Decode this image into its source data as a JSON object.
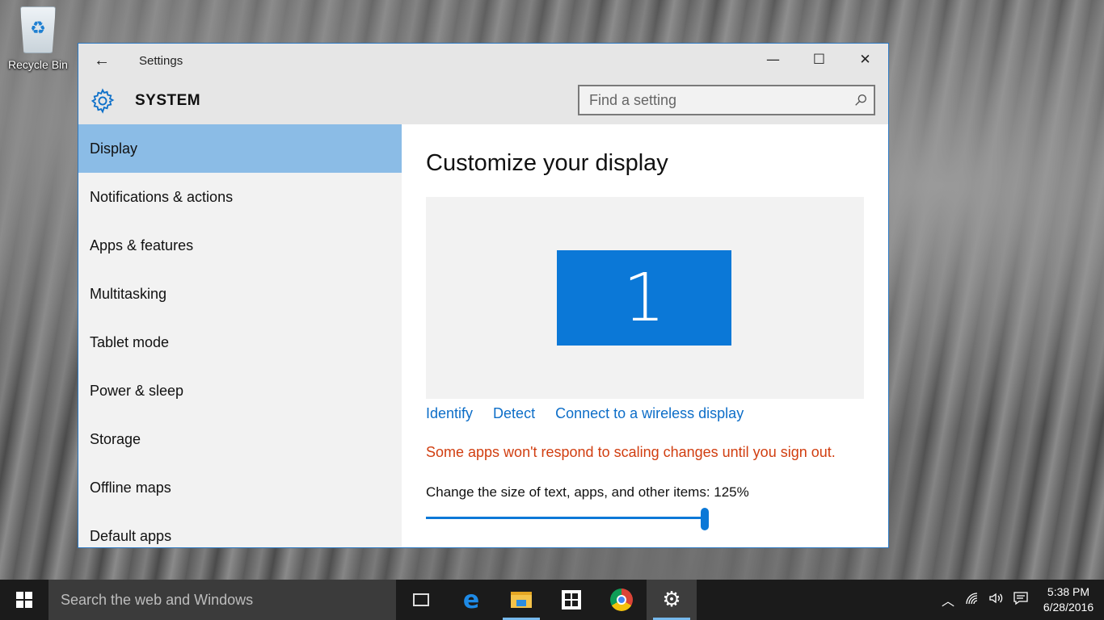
{
  "desktop": {
    "recycle_bin_label": "Recycle Bin"
  },
  "window": {
    "title": "Settings",
    "back_icon": "←",
    "minimize_icon": "—",
    "maximize_icon": "☐",
    "close_icon": "✕",
    "section_title": "SYSTEM",
    "search_placeholder": "Find a setting",
    "search_icon": "⚲"
  },
  "sidebar": {
    "items": [
      {
        "label": "Display",
        "active": true
      },
      {
        "label": "Notifications & actions"
      },
      {
        "label": "Apps & features"
      },
      {
        "label": "Multitasking"
      },
      {
        "label": "Tablet mode"
      },
      {
        "label": "Power & sleep"
      },
      {
        "label": "Storage"
      },
      {
        "label": "Offline maps"
      },
      {
        "label": "Default apps"
      }
    ]
  },
  "content": {
    "heading": "Customize your display",
    "monitor_number": "1",
    "links": {
      "identify": "Identify",
      "detect": "Detect",
      "wireless": "Connect to a wireless display"
    },
    "warning": "Some apps won't respond to scaling changes until you sign out.",
    "scale_label": "Change the size of text, apps, and other items: 125%",
    "scale_value_percent": 125
  },
  "taskbar": {
    "search_placeholder": "Search the web and Windows",
    "tray": {
      "chevron": "︿",
      "network": "📶",
      "volume": "🔊",
      "notifications": "🗨"
    },
    "clock": {
      "time": "5:38 PM",
      "date": "6/28/2016"
    }
  },
  "colors": {
    "accent": "#0b78d7",
    "selected_nav": "#8bbce6",
    "warning": "#d13e10",
    "link": "#0d6ec8"
  }
}
